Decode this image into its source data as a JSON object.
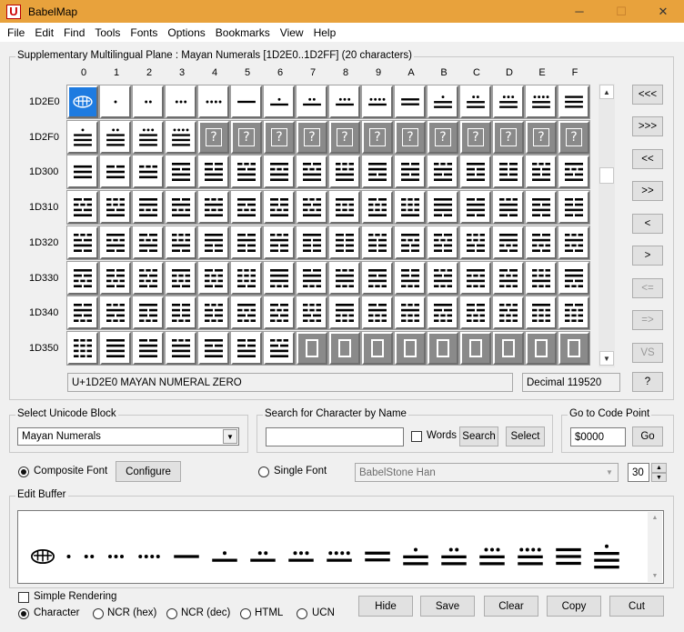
{
  "window": {
    "title": "BabelMap",
    "app_icon": "U",
    "min": "─",
    "max": "☐",
    "close": "✕"
  },
  "menu": [
    "File",
    "Edit",
    "Find",
    "Tools",
    "Fonts",
    "Options",
    "Bookmarks",
    "View",
    "Help"
  ],
  "grid_panel": {
    "label": "Supplementary Multilingual Plane : Mayan Numerals [1D2E0..1D2FF] (20 characters)",
    "columns": [
      "0",
      "1",
      "2",
      "3",
      "4",
      "5",
      "6",
      "7",
      "8",
      "9",
      "A",
      "B",
      "C",
      "D",
      "E",
      "F"
    ],
    "rows": [
      "1D2E0",
      "1D2F0",
      "1D300",
      "1D310",
      "1D320",
      "1D330",
      "1D340",
      "1D350"
    ],
    "status_name": "U+1D2E0 MAYAN NUMERAL ZERO",
    "status_decimal": "Decimal 119520",
    "nav_buttons": [
      "<<<",
      ">>>",
      "<<",
      ">>",
      "<",
      ">",
      "<=",
      "=>",
      "VS",
      "?"
    ]
  },
  "block_select": {
    "label": "Select Unicode Block",
    "value": "Mayan Numerals"
  },
  "search": {
    "label": "Search for Character by Name",
    "value": "",
    "words_label": "Words",
    "search_btn": "Search",
    "select_btn": "Select"
  },
  "goto": {
    "label": "Go to Code Point",
    "value": "$0000",
    "go_btn": "Go"
  },
  "font": {
    "composite_label": "Composite Font",
    "configure_btn": "Configure",
    "single_label": "Single Font",
    "single_value": "BabelStone Han",
    "size": "30"
  },
  "edit_buffer": {
    "label": "Edit Buffer"
  },
  "bottom": {
    "simple_rendering": "Simple Rendering",
    "formats": [
      "Character",
      "NCR (hex)",
      "NCR (dec)",
      "HTML",
      "UCN"
    ],
    "buttons": [
      "Hide",
      "Save",
      "Clear",
      "Copy",
      "Cut"
    ]
  },
  "colors": {
    "titlebar": "#e8a23c",
    "selected": "#1e7be0",
    "unassigned": "#8a8a8a"
  }
}
